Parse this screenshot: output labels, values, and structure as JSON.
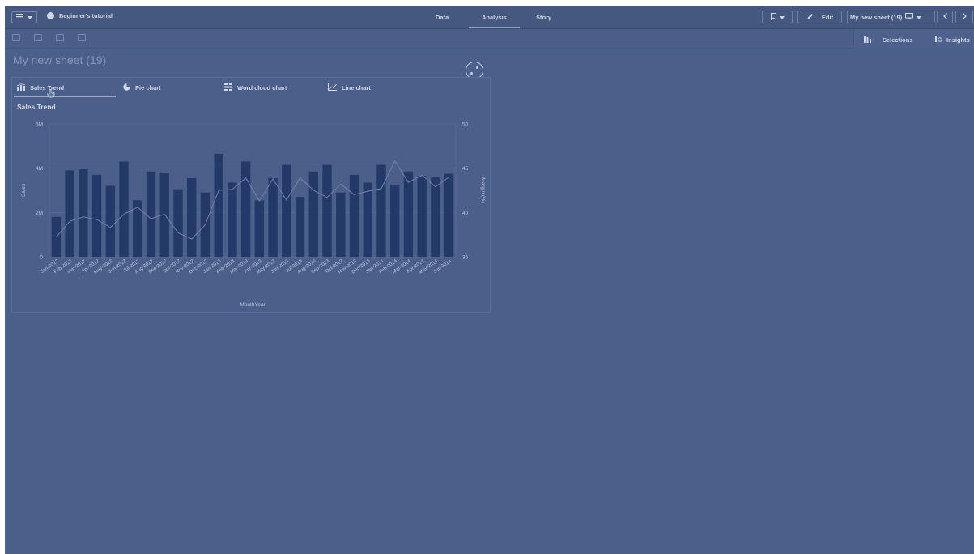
{
  "topbar": {
    "app_title": "Beginner's tutorial",
    "tabs": [
      {
        "label": "Data"
      },
      {
        "label": "Analysis"
      },
      {
        "label": "Story"
      }
    ],
    "edit_label": "Edit",
    "sheet_selector": "My new sheet (19)"
  },
  "right_panel": {
    "selections_label": "Selections",
    "insights_label": "Insights"
  },
  "sheet": {
    "title": "My new sheet (19)"
  },
  "chart_tabs": [
    {
      "label": "Sales Trend"
    },
    {
      "label": "Pie chart"
    },
    {
      "label": "Word cloud chart"
    },
    {
      "label": "Line chart"
    }
  ],
  "chart_data": {
    "type": "bar",
    "title": "Sales Trend",
    "xlabel": "MonthYear",
    "ylabel": "Sales",
    "y2label": "Margin (%)",
    "ylim": [
      0,
      6000000
    ],
    "y_ticks": [
      "0",
      "2M",
      "4M",
      "6M"
    ],
    "y2lim": [
      35,
      50
    ],
    "y2_ticks": [
      "35",
      "40",
      "45",
      "50"
    ],
    "categories": [
      "Jan-2012",
      "Feb-2012",
      "Mar-2012",
      "Apr-2012",
      "May-2012",
      "Jun-2012",
      "Jul-2012",
      "Aug-2012",
      "Sep-2012",
      "Oct-2012",
      "Nov-2012",
      "Dec-2012",
      "Jan-2013",
      "Feb-2013",
      "Mar-2013",
      "Apr-2013",
      "May-2013",
      "Jun-2013",
      "Jul-2013",
      "Aug-2013",
      "Sep-2013",
      "Oct-2013",
      "Nov-2013",
      "Dec-2013",
      "Jan-2014",
      "Feb-2014",
      "Mar-2014",
      "Apr-2014",
      "May-2014",
      "Jun-2014"
    ],
    "series": [
      {
        "values": [
          1800000,
          3900000,
          3950000,
          3700000,
          3200000,
          4300000,
          2550000,
          3850000,
          3800000,
          3050000,
          3550000,
          2900000,
          4650000,
          3350000,
          4300000,
          2550000,
          3550000,
          4150000,
          2700000,
          3850000,
          4150000,
          2900000,
          3700000,
          3350000,
          4150000,
          3250000,
          3850000,
          3650000,
          3600000,
          3750000
        ]
      },
      {
        "type": "line",
        "axis": "secondary",
        "values": [
          37.2,
          39.0,
          39.5,
          39.2,
          38.3,
          39.8,
          40.6,
          39.3,
          39.8,
          37.7,
          37.0,
          38.6,
          42.5,
          42.6,
          43.9,
          41.3,
          43.8,
          41.4,
          43.9,
          42.5,
          41.7,
          43.2,
          42.0,
          42.4,
          42.7,
          45.8,
          43.4,
          44.2,
          42.9,
          44.0
        ]
      }
    ],
    "colors": {
      "bars": "#233a69",
      "line": "#7283aa",
      "grid": "#5b6e98",
      "text": "#bcc6dc"
    }
  }
}
